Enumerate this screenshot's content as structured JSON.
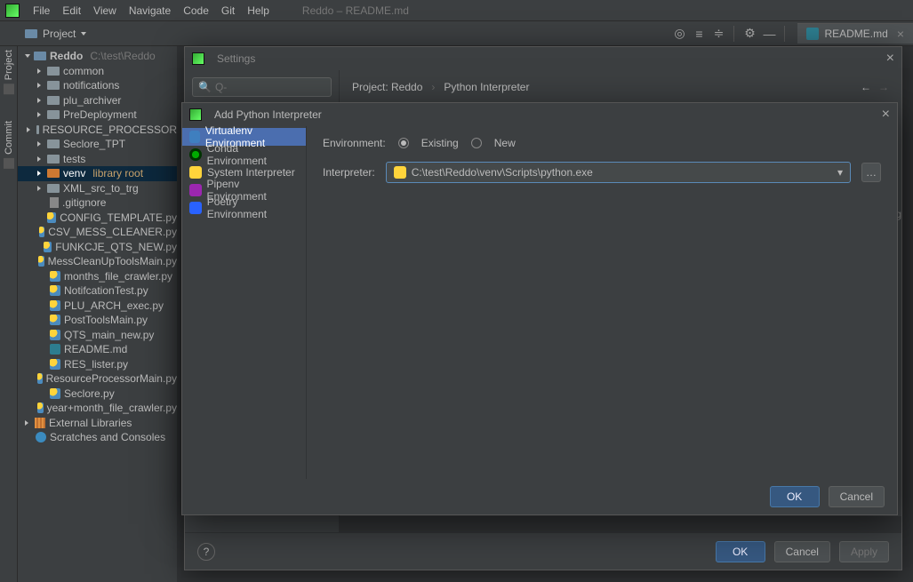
{
  "window_title": "Reddo – README.md",
  "menubar": [
    "File",
    "Edit",
    "View",
    "Navigate",
    "Code",
    "Git",
    "Help"
  ],
  "project_label": "Project",
  "editor_tab": {
    "name": "README.md"
  },
  "tree": {
    "root": "Reddo",
    "root_path": "C:\\test\\Reddo",
    "folders": [
      "common",
      "notifications",
      "plu_archiver",
      "PreDeployment",
      "RESOURCE_PROCESSOR",
      "Seclore_TPT",
      "tests"
    ],
    "venv": "venv",
    "venv_note": "library root",
    "xml": "XML_src_to_trg",
    "files": [
      {
        "n": ".gitignore",
        "t": "file"
      },
      {
        "n": "CONFIG_TEMPLATE.py",
        "t": "py"
      },
      {
        "n": "CSV_MESS_CLEANER.py",
        "t": "py"
      },
      {
        "n": "FUNKCJE_QTS_NEW.py",
        "t": "py"
      },
      {
        "n": "MessCleanUpToolsMain.py",
        "t": "py"
      },
      {
        "n": "months_file_crawler.py",
        "t": "py"
      },
      {
        "n": "NotifcationTest.py",
        "t": "py"
      },
      {
        "n": "PLU_ARCH_exec.py",
        "t": "py"
      },
      {
        "n": "PostToolsMain.py",
        "t": "py"
      },
      {
        "n": "QTS_main_new.py",
        "t": "py"
      },
      {
        "n": "README.md",
        "t": "md"
      },
      {
        "n": "RES_lister.py",
        "t": "py"
      },
      {
        "n": "ResourceProcessorMain.py",
        "t": "py"
      },
      {
        "n": "Seclore.py",
        "t": "py"
      },
      {
        "n": "year+month_file_crawler.py",
        "t": "py"
      }
    ],
    "ext_lib": "External Libraries",
    "scratches": "Scratches and Consoles"
  },
  "gutters": {
    "project": "Project",
    "commit": "Commit"
  },
  "settings": {
    "title": "Settings",
    "search_placeholder": "Q-",
    "crumb1": "Project: Reddo",
    "crumb2": "Python Interpreter",
    "ok": "OK",
    "cancel": "Cancel",
    "apply": "Apply"
  },
  "interp": {
    "title": "Add Python Interpreter",
    "options": [
      "Virtualenv Environment",
      "Conda Environment",
      "System Interpreter",
      "Pipenv Environment",
      "Poetry Environment"
    ],
    "env_label": "Environment:",
    "existing": "Existing",
    "new": "New",
    "interpreter_label": "Interpreter:",
    "interpreter_value": "C:\\test\\Reddo\\venv\\Scripts\\python.exe",
    "ok": "OK",
    "cancel": "Cancel"
  },
  "right_cut": "ng"
}
